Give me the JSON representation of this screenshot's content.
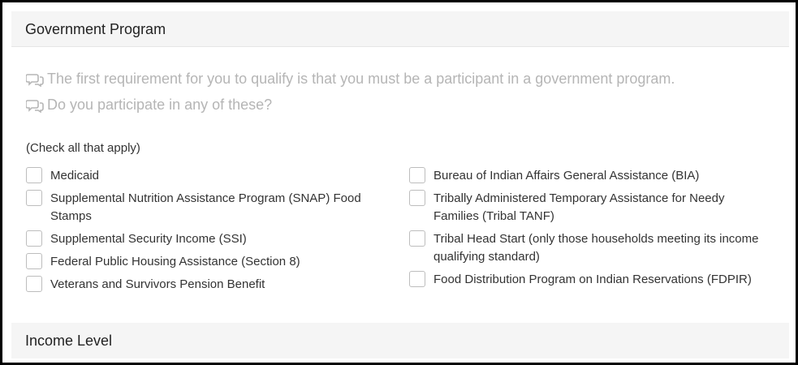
{
  "sections": {
    "government_program": {
      "title": "Government Program",
      "prompt_line1": "The first requirement for you to qualify is that you must be a participant in a government program.",
      "prompt_line2": "Do you participate in any of these?",
      "instruction": "(Check all that apply)",
      "options_left": [
        {
          "label": "Medicaid",
          "checked": false
        },
        {
          "label": "Supplemental Nutrition Assistance Program (SNAP) Food Stamps",
          "checked": false
        },
        {
          "label": "Supplemental Security Income (SSI)",
          "checked": false
        },
        {
          "label": "Federal Public Housing Assistance (Section 8)",
          "checked": false
        },
        {
          "label": "Veterans and Survivors Pension Benefit",
          "checked": false
        }
      ],
      "options_right": [
        {
          "label": "Bureau of Indian Affairs General Assistance (BIA)",
          "checked": false
        },
        {
          "label": "Tribally Administered Temporary Assistance for Needy Families (Tribal TANF)",
          "checked": false
        },
        {
          "label": "Tribal Head Start (only those households meeting its income qualifying standard)",
          "checked": false
        },
        {
          "label": "Food Distribution Program on Indian Reservations (FDPIR)",
          "checked": false
        }
      ]
    },
    "income_level": {
      "title": "Income Level"
    }
  },
  "icons": {
    "prompt_icon": "comments-icon"
  },
  "colors": {
    "header_bg": "#f5f5f5",
    "prompt_text": "#b5b5b5",
    "border": "#000000"
  }
}
